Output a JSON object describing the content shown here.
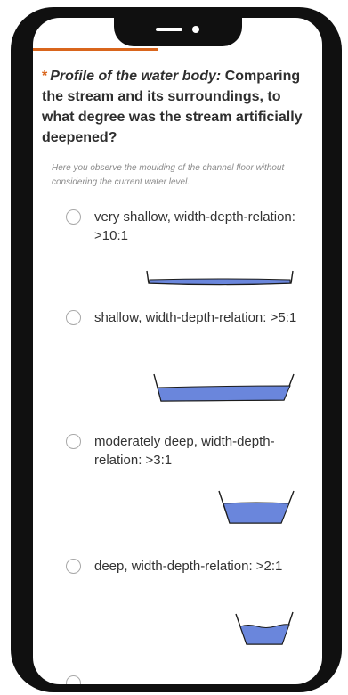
{
  "question": {
    "required_mark": "*",
    "title_italic": "Profile of the water body:",
    "title_rest": "Comparing the stream and its surroundings, to what degree was the stream artificially deepened?",
    "hint": "Here you observe the moulding of the channel floor without considering the current water level."
  },
  "options": [
    {
      "label": "very shallow, width-depth-relation: >10:1",
      "illustration": "very-shallow-channel"
    },
    {
      "label": "shallow, width-depth-relation: >5:1",
      "illustration": "shallow-channel"
    },
    {
      "label": "moderately deep, width-depth-relation: >3:1",
      "illustration": "moderately-deep-channel"
    },
    {
      "label": "deep, width-depth-relation: >2:1",
      "illustration": "deep-channel"
    }
  ],
  "colors": {
    "accent": "#d9651c",
    "water": "#6a86dc",
    "phone_frame": "#101010"
  }
}
